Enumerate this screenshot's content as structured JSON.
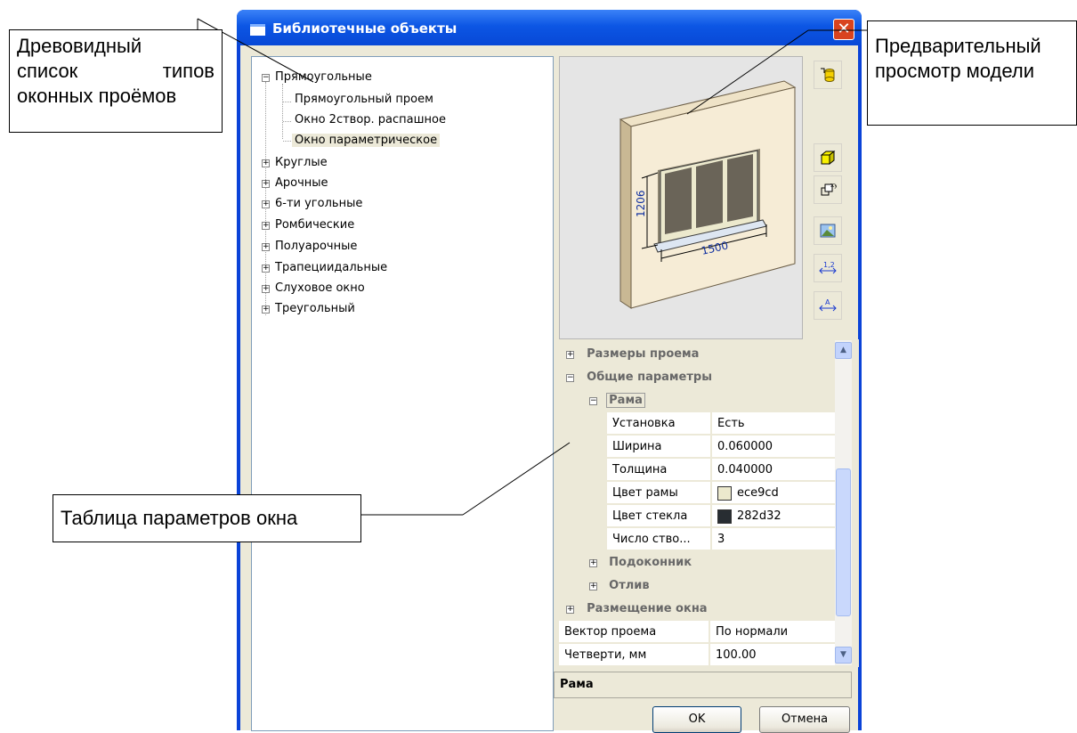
{
  "window": {
    "title": "Библиотечные объекты",
    "close_glyph": "✕"
  },
  "tree": {
    "items": [
      {
        "label": "Прямоугольные",
        "expander": "−"
      },
      {
        "label": "Прямоугольный проем"
      },
      {
        "label": "Окно 2створ. распашное"
      },
      {
        "label": "Окно параметрическое",
        "selected": true
      },
      {
        "label": "Круглые",
        "expander": "+"
      },
      {
        "label": "Арочные",
        "expander": "+"
      },
      {
        "label": "6-ти угольные",
        "expander": "+"
      },
      {
        "label": "Ромбические",
        "expander": "+"
      },
      {
        "label": "Полуарочные",
        "expander": "+"
      },
      {
        "label": "Трапециидальные",
        "expander": "+"
      },
      {
        "label": "Слуховое окно",
        "expander": "+"
      },
      {
        "label": "Треугольный",
        "expander": "+"
      }
    ]
  },
  "preview": {
    "dim_height": "1206",
    "dim_width": "1500",
    "wall_color": "#f3e7cf",
    "glass_color": "#282d32"
  },
  "side_icons": [
    "database-icon",
    "cube-view-icon",
    "xy-plane-icon",
    "render-image-icon",
    "dimension-numbers-icon",
    "dimension-letters-icon"
  ],
  "props": {
    "cat_size": "Размеры проема",
    "cat_general": "Общие параметры",
    "sub_frame": "Рама",
    "rows": [
      {
        "name": "Установка",
        "value": "Есть"
      },
      {
        "name": "Ширина",
        "value": "0.060000"
      },
      {
        "name": "Толщина",
        "value": "0.040000"
      },
      {
        "name": "Цвет рамы",
        "value": "ece9cd",
        "swatch": "#ece9cd"
      },
      {
        "name": "Цвет стекла",
        "value": "282d32",
        "swatch": "#282d32"
      },
      {
        "name": "Число ство...",
        "value": "3"
      }
    ],
    "sub_sill": "Подоконник",
    "sub_drip": "Отлив",
    "cat_placement": "Размещение окна",
    "rows2": [
      {
        "name": "Вектор проема",
        "value": "По нормали"
      },
      {
        "name": "Четверти, мм",
        "value": "100.00"
      }
    ]
  },
  "status_text": "Рама",
  "buttons": {
    "ok": "OK",
    "cancel": "Отмена"
  },
  "callouts": {
    "tree_line1": "Древовидный",
    "tree_line2_a": "список",
    "tree_line2_b": "типов",
    "tree_line3": "оконных проёмов",
    "preview_line1": "Предварительный",
    "preview_line2": "просмотр модели",
    "table": "Таблица параметров окна"
  }
}
